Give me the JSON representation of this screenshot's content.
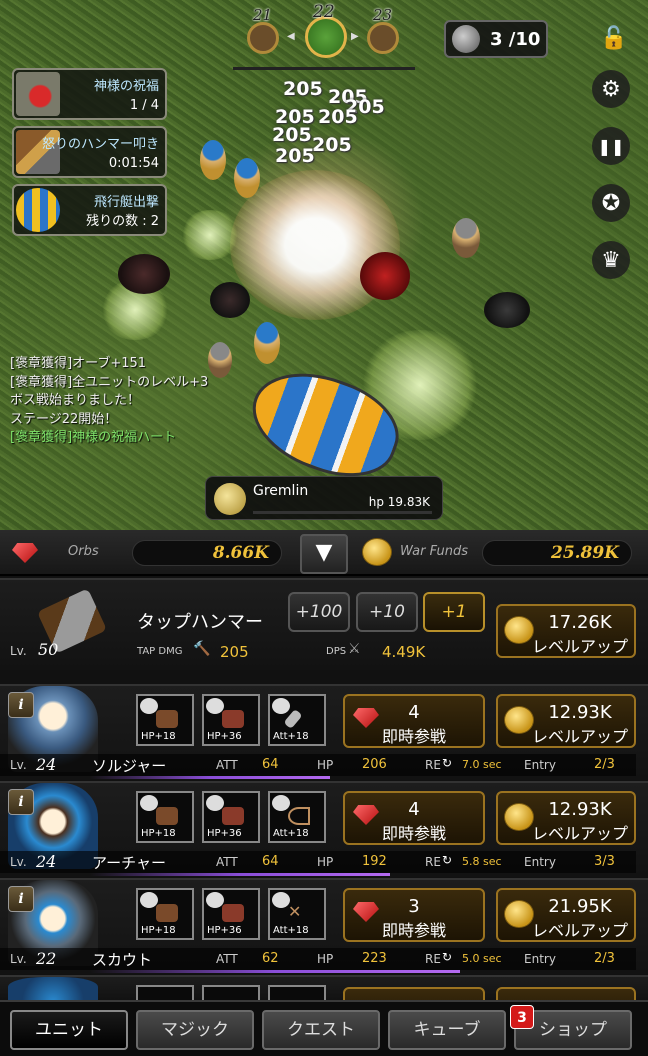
{
  "stage": {
    "prev": "21",
    "current": "22",
    "next": "23"
  },
  "boss_counter": "3 /10",
  "buffs": [
    {
      "title": "神様の祝福",
      "sub": "1 / 4"
    },
    {
      "title": "怒りのハンマー叩き",
      "sub": "0:01:54"
    },
    {
      "title": "飛行艇出撃",
      "sub": "残りの数 : 2"
    }
  ],
  "log": [
    "[褒章獲得]オーブ+151",
    "[褒章獲得]全ユニットのレベル+3",
    "ボス戦始まりました！",
    "ステージ22開始！",
    "[褒章獲得]神様の祝福ハート"
  ],
  "damage_numbers": [
    "205",
    "205",
    "205",
    "205",
    "205",
    "205",
    "205",
    "205"
  ],
  "boss": {
    "name": "Gremlin",
    "hp": "hp 19.83K"
  },
  "currency": {
    "orbs_label": "Orbs",
    "orbs": "8.66K",
    "funds_label": "War Funds",
    "funds": "25.89K"
  },
  "hammer": {
    "name": "タップハンマー",
    "lv_label": "Lv.",
    "lv": "50",
    "tap_label": "TAP DMG",
    "tap_value": "205",
    "dps_label": "DPS",
    "dps_value": "4.49K",
    "mult": [
      "+100",
      "+10",
      "+1"
    ],
    "cost": "17.26K",
    "action": "レベルアップ"
  },
  "units": [
    {
      "name": "ソルジャー",
      "lv": "24",
      "att": "64",
      "hp": "206",
      "re": "7.0 sec",
      "entry": "2/3",
      "orb_cost": "4",
      "orb_action": "即時参戦",
      "cost": "12.93K",
      "action": "レベルアップ",
      "equip": [
        "HP+18",
        "HP+36",
        "Att+18"
      ]
    },
    {
      "name": "アーチャー",
      "lv": "24",
      "att": "64",
      "hp": "192",
      "re": "5.8 sec",
      "entry": "3/3",
      "orb_cost": "4",
      "orb_action": "即時参戦",
      "cost": "12.93K",
      "action": "レベルアップ",
      "equip": [
        "HP+18",
        "HP+36",
        "Att+18"
      ]
    },
    {
      "name": "スカウト",
      "lv": "22",
      "att": "62",
      "hp": "223",
      "re": "5.0 sec",
      "entry": "2/3",
      "orb_cost": "3",
      "orb_action": "即時参戦",
      "cost": "21.95K",
      "action": "レベルアップ",
      "equip": [
        "HP+18",
        "HP+36",
        "Att+18"
      ]
    }
  ],
  "stat_labels": {
    "lv": "Lv.",
    "att": "ATT",
    "hp": "HP",
    "re": "RE",
    "entry": "Entry",
    "info": "i"
  },
  "tabs": [
    "ユニット",
    "マジック",
    "クエスト",
    "キューブ",
    "ショップ"
  ],
  "shop_badge": "3",
  "colors": {
    "gold": "#f0c23b",
    "green_log": "#7fe36a",
    "badge": "#d41a1a"
  }
}
